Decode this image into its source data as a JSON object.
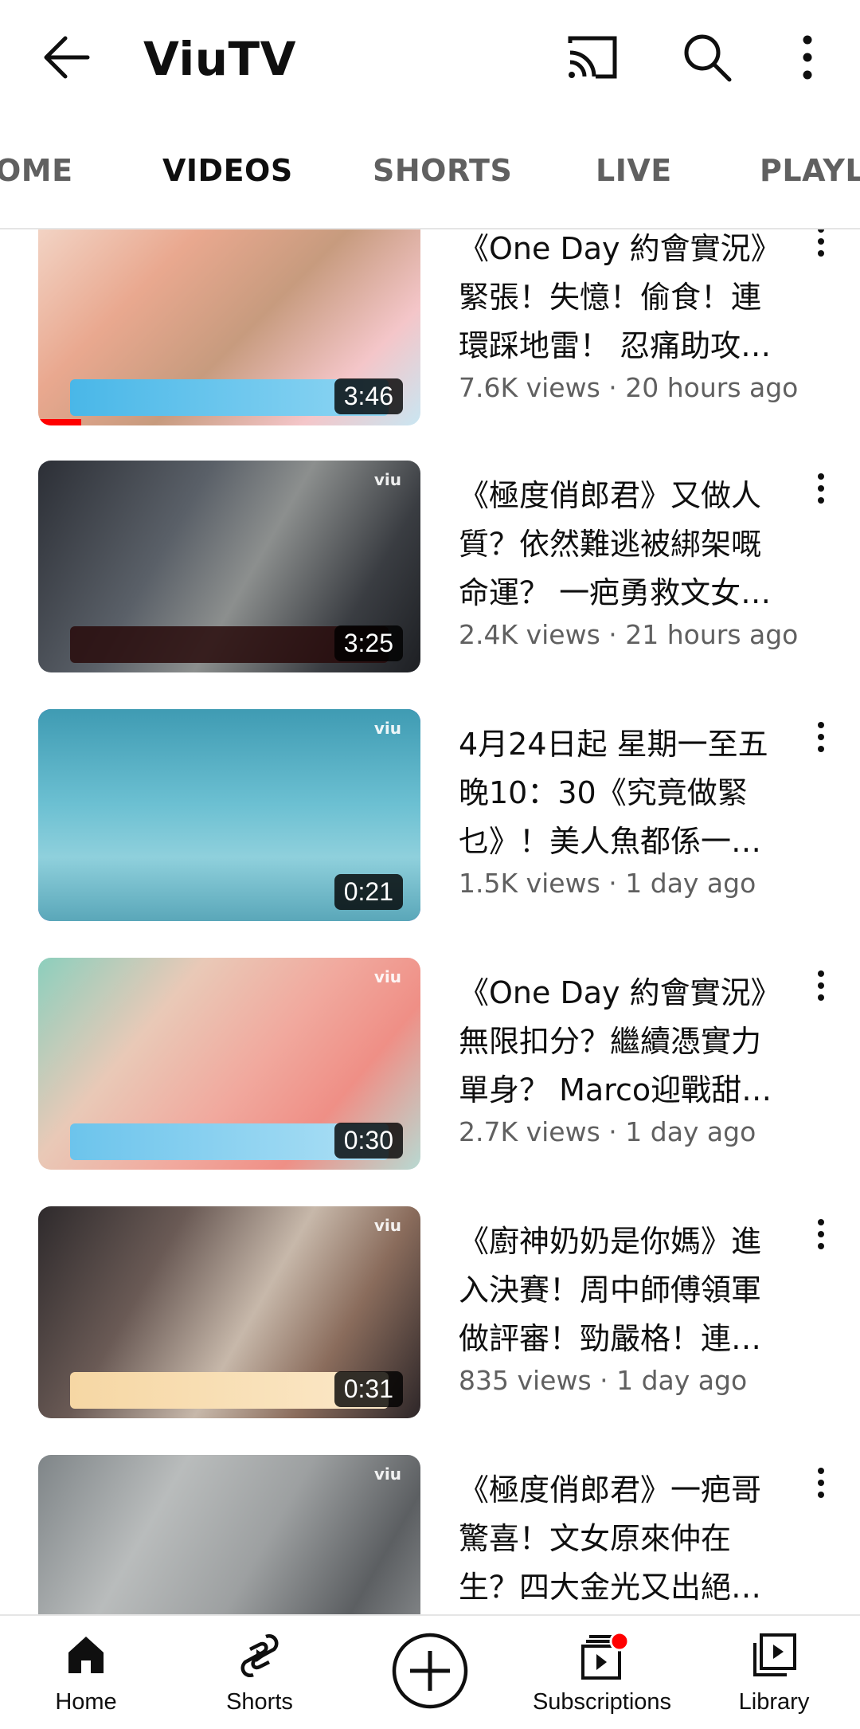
{
  "header": {
    "title": "ViuTV",
    "icons": [
      "back-arrow-icon",
      "cast-icon",
      "search-icon",
      "more-vert-icon"
    ]
  },
  "tabs": [
    {
      "label": "OME",
      "active": false
    },
    {
      "label": "VIDEOS",
      "active": true
    },
    {
      "label": "SHORTS",
      "active": false
    },
    {
      "label": "LIVE",
      "active": false
    },
    {
      "label": "PLAYL",
      "active": false
    }
  ],
  "videos": [
    {
      "title_lines": [
        "《One Day 約會實況》",
        "緊張！失憶！偷食！連",
        "環踩地雷！ 忍痛助攻…"
      ],
      "stats": "7.6K views · 20 hours ago",
      "duration": "3:46"
    },
    {
      "title_lines": [
        "《極度俏郎君》又做人",
        "質？依然難逃被綁架嘅",
        "命運？ 一疤勇救文女…"
      ],
      "stats": "2.4K views · 21 hours ago",
      "duration": "3:25"
    },
    {
      "title_lines": [
        "4月24日起 星期一至五",
        "晚10：30《究竟做緊",
        "乜》！美人魚都係一…"
      ],
      "stats": "1.5K views · 1 day ago",
      "duration": "0:21"
    },
    {
      "title_lines": [
        "《One Day 約會實況》",
        "無限扣分？繼續憑實力",
        "單身？ Marco迎戰甜…"
      ],
      "stats": "2.7K views · 1 day ago",
      "duration": "0:30"
    },
    {
      "title_lines": [
        "《廚神奶奶是你媽》進",
        "入決賽！周中師傅領軍",
        "做評審！勁嚴格！連…"
      ],
      "stats": "835 views · 1 day ago",
      "duration": "0:31"
    },
    {
      "title_lines": [
        "《極度俏郎君》一疤哥",
        "驚喜！文女原來仲在",
        "生？四大金光又出絕…"
      ],
      "stats": "",
      "duration": ""
    }
  ],
  "bottom_nav": [
    {
      "label": "Home",
      "icon": "home-icon"
    },
    {
      "label": "Shorts",
      "icon": "shorts-icon"
    },
    {
      "label": "",
      "icon": "create-plus-icon"
    },
    {
      "label": "Subscriptions",
      "icon": "subscriptions-icon"
    },
    {
      "label": "Library",
      "icon": "library-icon"
    }
  ],
  "colors": {
    "accent": "#ff0000",
    "text": "#0f0f0f",
    "secondary": "#606060",
    "highlight_border": "#6b3fd6"
  }
}
